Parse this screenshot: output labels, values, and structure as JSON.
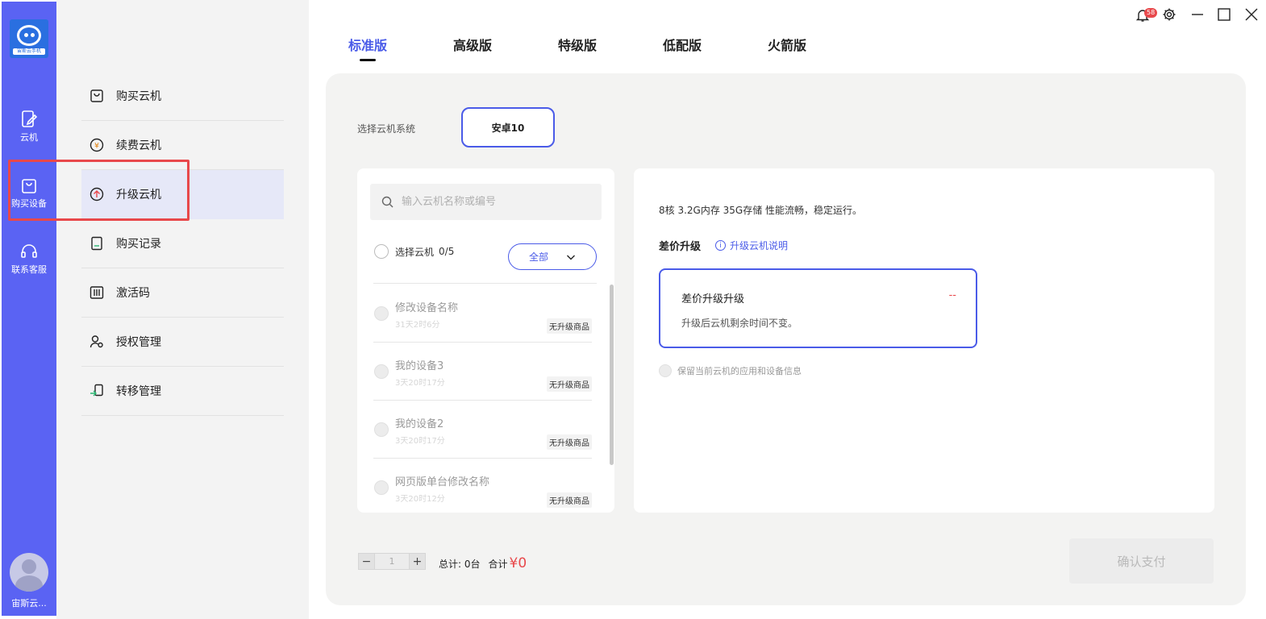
{
  "rail": {
    "logo_text": "宙斯云手机",
    "items": [
      {
        "label": "云机",
        "icon": "phone-edit-icon"
      },
      {
        "label": "购买设备",
        "icon": "shopping-bag-icon"
      },
      {
        "label": "联系客服",
        "icon": "headset-icon"
      }
    ],
    "username": "宙斯云..."
  },
  "sidebar": {
    "items": [
      {
        "label": "购买云机",
        "icon": "bag-icon"
      },
      {
        "label": "续费云机",
        "icon": "yen-coin-icon"
      },
      {
        "label": "升级云机",
        "icon": "upgrade-arrow-icon",
        "active": true
      },
      {
        "label": "购买记录",
        "icon": "receipt-icon"
      },
      {
        "label": "激活码",
        "icon": "barcode-icon"
      },
      {
        "label": "授权管理",
        "icon": "user-key-icon"
      },
      {
        "label": "转移管理",
        "icon": "transfer-icon"
      }
    ]
  },
  "header": {
    "notification_count": "58",
    "tabs": [
      {
        "label": "标准版",
        "active": true
      },
      {
        "label": "高级版"
      },
      {
        "label": "特级版"
      },
      {
        "label": "低配版"
      },
      {
        "label": "火箭版"
      }
    ]
  },
  "system": {
    "label": "选择云机系统",
    "selected": "安卓10"
  },
  "device_list": {
    "search_placeholder": "输入云机名称或编号",
    "select_label": "选择云机",
    "select_count": "0/5",
    "filter_label": "全部",
    "devices": [
      {
        "name": "修改设备名称",
        "time": "31天2时6分",
        "tag": "无升级商品"
      },
      {
        "name": "我的设备3",
        "time": "3天20时17分",
        "tag": "无升级商品"
      },
      {
        "name": "我的设备2",
        "time": "3天20时17分",
        "tag": "无升级商品"
      },
      {
        "name": "网页版单台修改名称",
        "time": "3天20时12分",
        "tag": "无升级商品"
      }
    ]
  },
  "detail": {
    "spec": "8核 3.2G内存 35G存储 性能流畅，稳定运行。",
    "upgrade_title": "差价升级",
    "upgrade_help": "升级云机说明",
    "option_name": "差价升级升级",
    "option_price": "--",
    "option_desc": "升级后云机剩余时间不变。",
    "keep_label": "保留当前云机的应用和设备信息"
  },
  "footer": {
    "quantity": "1",
    "total_label": "总计: 0台",
    "sum_label": "合计",
    "price": "¥0",
    "pay_label": "确认支付"
  },
  "colors": {
    "accent": "#4a5be8",
    "rail": "#5a63f3",
    "highlight": "#e8484b"
  }
}
